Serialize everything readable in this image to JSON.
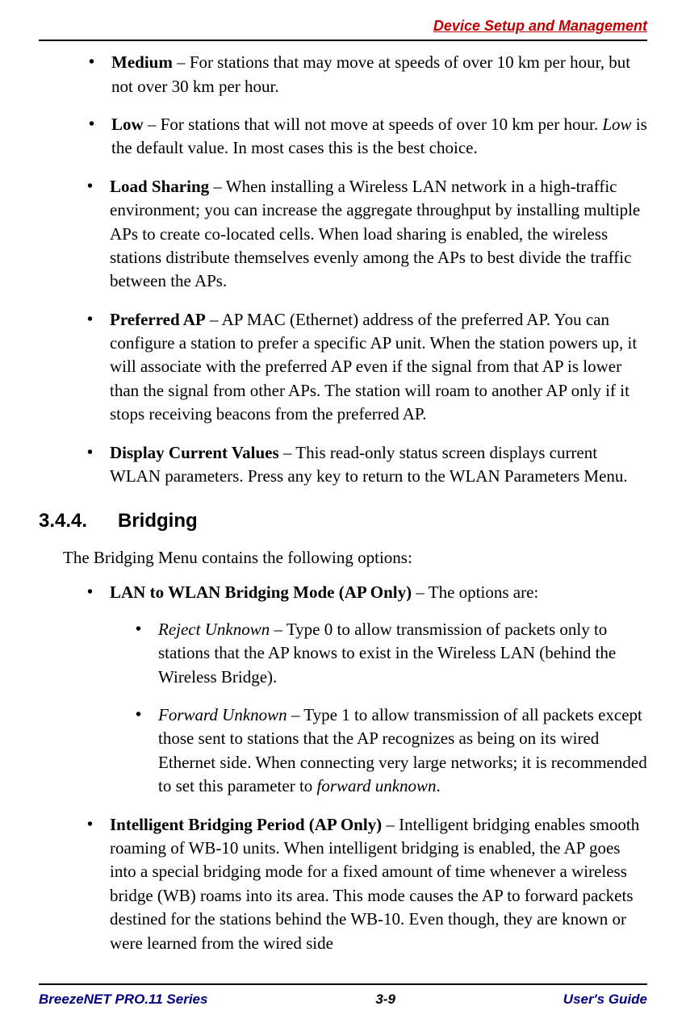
{
  "header": {
    "title": "Device Setup and Management"
  },
  "speed_items": {
    "medium": {
      "label": "Medium",
      "text": " – For stations that may move at speeds of over 10 km per hour, but not over 30 km per hour."
    },
    "low": {
      "label": "Low",
      "text_before_italic": "  – For stations that will not move at speeds of over 10 km per hour. ",
      "italic_word": "Low",
      "text_after_italic": " is the default value. In most cases this is the best choice."
    }
  },
  "main_items": {
    "load_sharing": {
      "label": "Load Sharing",
      "text": " – When installing a Wireless LAN network in a high-traffic environment; you can increase the aggregate throughput by installing multiple APs to create co-located cells. When load sharing is enabled, the wireless stations distribute themselves evenly among the APs to best divide the traffic between the APs."
    },
    "preferred_ap": {
      "label": "Preferred AP",
      "text": " – AP MAC (Ethernet) address of the preferred AP. You can configure a station to prefer a specific AP unit. When the station powers up, it will associate with the preferred AP even if the signal from that AP is lower than the signal from other APs. The station will roam to another AP only if it stops receiving beacons from the preferred AP."
    },
    "display_current": {
      "label": "Display Current Values",
      "text": " – This read-only status screen displays current WLAN parameters. Press any key to return to the WLAN Parameters Menu."
    }
  },
  "section": {
    "number": "3.4.4.",
    "title": "Bridging",
    "intro": "The Bridging Menu contains the following options:"
  },
  "bridging_items": {
    "lan_to_wlan": {
      "label": "LAN to WLAN Bridging Mode (AP Only)",
      "text": " – The options are:",
      "options": {
        "reject": {
          "label": "Reject Unknown",
          "text": " – Type 0 to allow transmission of packets only to stations that the AP knows to exist in the Wireless LAN (behind the Wireless Bridge)."
        },
        "forward": {
          "label": "Forward Unknown",
          "text_before_italic": " – Type 1 to allow transmission of all packets except those sent to stations that the AP recognizes as being on its wired Ethernet side. When connecting very large networks; it is recommended to set this parameter to ",
          "italic_word": "forward unknown",
          "text_after_italic": "."
        }
      }
    },
    "intelligent_bridging": {
      "label": "Intelligent Bridging Period (AP Only)",
      "text": " – Intelligent bridging enables smooth roaming of WB-10 units. When intelligent bridging is enabled, the AP goes into a special bridging mode for a fixed amount of time whenever a wireless bridge (WB) roams into its area. This mode causes the AP to forward packets destined for the stations behind the WB-10. Even though, they are known or were learned from the wired side"
    }
  },
  "footer": {
    "left": "BreezeNET PRO.11 Series",
    "center": "3-9",
    "right": "User's Guide"
  }
}
